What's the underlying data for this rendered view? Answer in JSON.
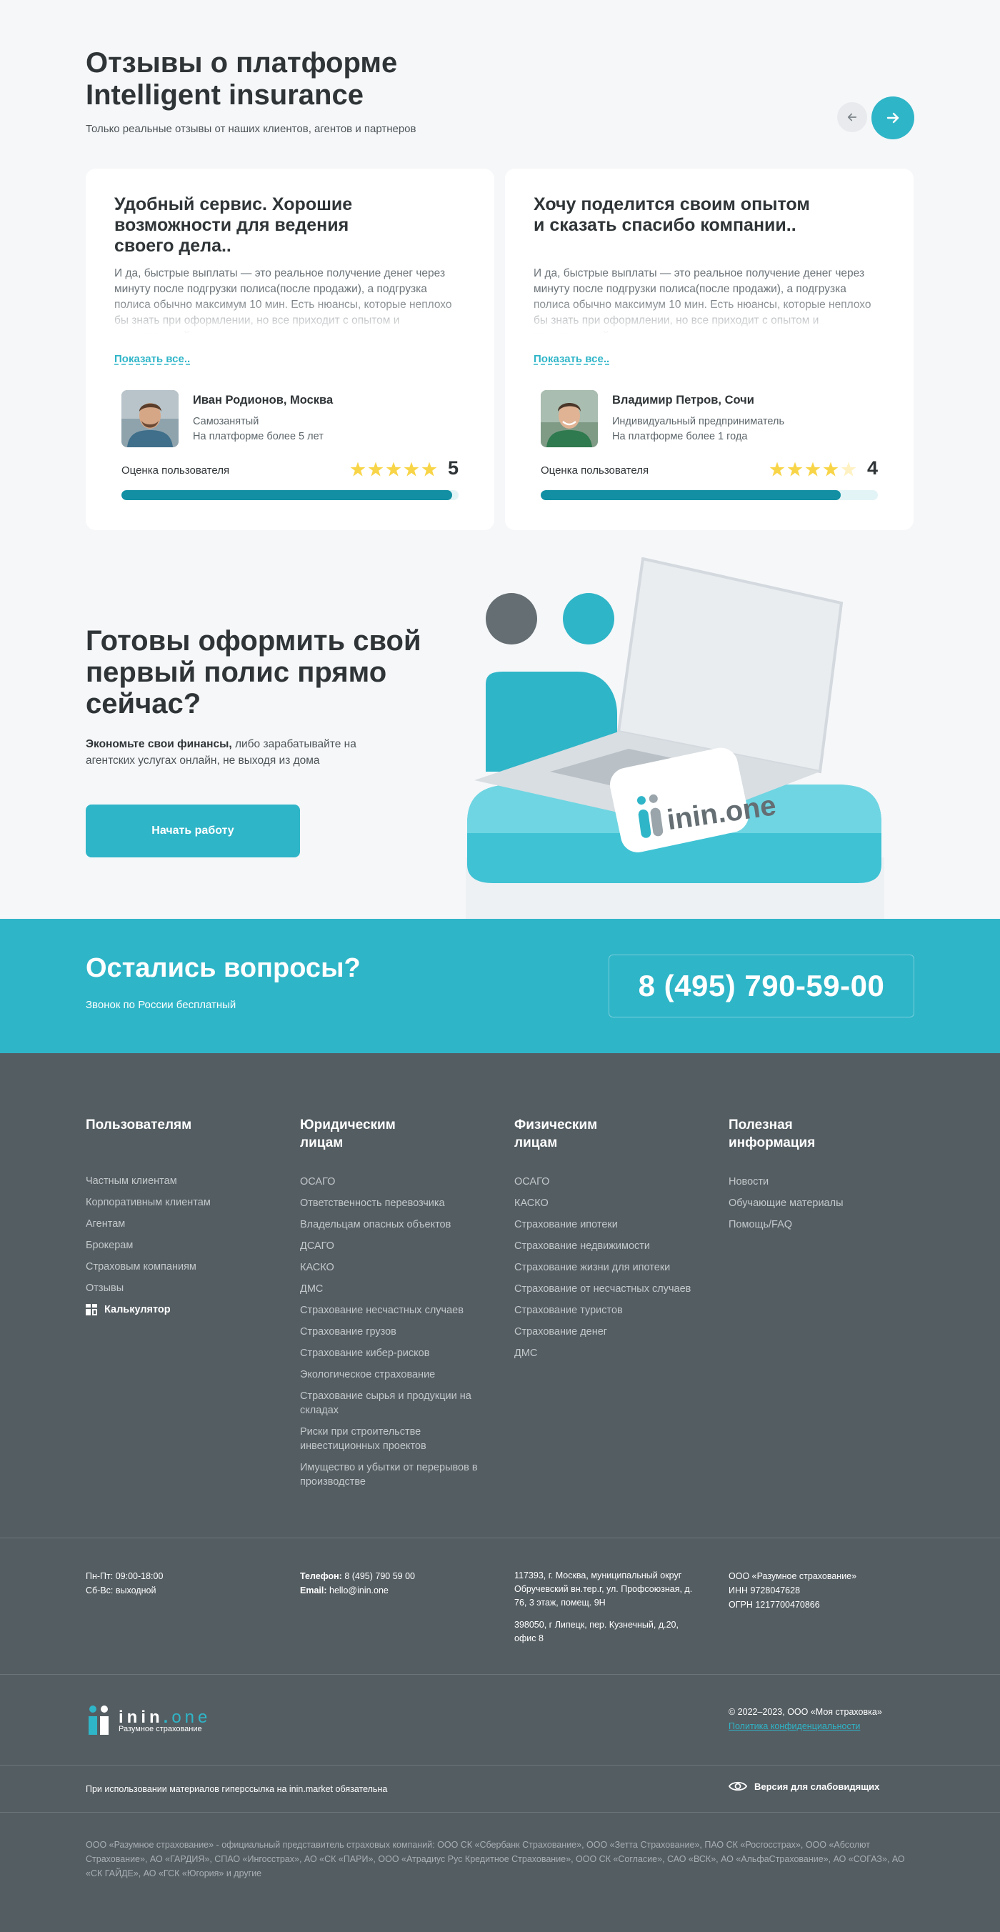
{
  "reviews": {
    "title_line1": "Отзывы о платформе",
    "title_line2": "Intelligent insurance",
    "subtitle": "Только реальные отзывы от наших клиентов, агентов и партнеров",
    "prev_icon": "arrow-left-icon",
    "next_icon": "arrow-right-icon",
    "items": [
      {
        "title": "Удобный сервис. Хорошие возможности для ведения своего дела..",
        "text": "И да, быстрые выплаты — это реальное получение денег через минуту после подгрузки полиса(после продажи), а подгрузка полиса обычно максимум 10 мин. Есть нюансы, которые неплохо бы знать при оформлении, но все приходит с опытом и консультацией.",
        "more": "Показать все..",
        "name": "Иван Родионов, Москва",
        "role": "Самозанятый",
        "tenure": "На платформе более 5 лет",
        "score_label": "Оценка пользователя",
        "score": "5",
        "rating": 5,
        "bar_fraction": 0.98
      },
      {
        "title": "Хочу поделится своим опытом и сказать спасибо компании..",
        "text": "И да, быстрые выплаты — это реальное получение денег через минуту после подгрузки полиса(после продажи), а подгрузка полиса обычно максимум 10 мин. Есть нюансы, которые неплохо бы знать при оформлении, но все приходит с опытом и консультацией.",
        "more": "Показать все..",
        "name": "Владимир Петров, Сочи",
        "role": "Индивидуальный предприниматель",
        "tenure": "На платформе более 1 года",
        "score_label": "Оценка пользователя",
        "score": "4",
        "rating": 4,
        "bar_fraction": 0.89
      }
    ]
  },
  "cta": {
    "title_line1": "Готовы оформить свой",
    "title_line2": "первый полис прямо",
    "title_line3": "сейчас?",
    "text_bold": "Экономьте свои финансы,",
    "text_rest": " либо зарабатывайте на агентских услугах онлайн, не выходя из дома",
    "button": "Начать работу",
    "illus_brand": "inin.one"
  },
  "band": {
    "title": "Остались вопросы?",
    "subtitle": "Звонок по России бесплатный",
    "phone": "8 (495) 790-59-00"
  },
  "footer": {
    "columns": [
      {
        "title": "Пользователям",
        "items": [
          "Частным клиентам",
          "Корпоративным клиентам",
          "Агентам",
          "Брокерам",
          "Страховым компаниям",
          "Отзывы"
        ],
        "extra": "Калькулятор"
      },
      {
        "title": "Юридическим лицам",
        "items": [
          "ОСАГО",
          "Ответственность перевозчика",
          "Владельцам опасных объектов",
          "ДСАГО",
          "КАСКО",
          "ДМС",
          "Страхование несчастных случаев",
          "Страхование грузов",
          "Страхование кибер-рисков",
          "Экологическое страхование",
          "Страхование сырья и продукции на складах",
          "Риски при строительстве инвестиционных проектов",
          "Имущество и убытки от перерывов в производстве"
        ]
      },
      {
        "title": "Физическим лицам",
        "items": [
          "ОСАГО",
          "КАСКО",
          "Страхование ипотеки",
          "Страхование недвижимости",
          "Страхование жизни для ипотеки",
          "Страхование от несчастных случаев",
          "Страхование туристов",
          "Страхование денег",
          "ДМС"
        ]
      },
      {
        "title": "Полезная информация",
        "items": [
          "Новости",
          "Обучающие материалы",
          "Помощь/FAQ"
        ]
      }
    ],
    "hours_1": "Пн-Пт: 09:00-18:00",
    "hours_2": "Сб-Вс: выходной",
    "phone_label": "Телефон:",
    "phone": "8 (495) 790 59 00",
    "email_label": "Email:",
    "email": "hello@inin.one",
    "address_1": "117393, г. Москва, муниципальный округ Обручевский вн.тер.г, ул. Профсоюзная, д. 76, 3 этаж, помещ. 9Н",
    "address_2": "398050, г Липецк, пер. Кузнечный, д.20, офис 8",
    "company": "ООО «Разумное страхование»",
    "inn": "ИНН 9728047628",
    "ogrn": "ОГРН 1217700470866",
    "logo_main": "inin",
    "logo_dot": ".",
    "logo_one": "one",
    "logo_tagline": "Разумное страхование",
    "copyright": "© 2022–2023, ООО «Моя страховка»",
    "privacy": "Политика конфиденциальности",
    "usage_note": "При использовании материалов гиперссылка на inin.market обязательна",
    "a11y": "Версия для слабовидящих",
    "legal": "ООО «Разумное страхование» - официальный представитель страховых компаний: ООО СК «Сбербанк Страхование», ООО «Зетта Страхование», ПАО СК «Росгосстрах», ООО «Абсолют Страхование», АО «ГАРДИЯ», СПАО «Ингосстрах», АО «СК «ПАРИ», ООО «Атрадиус Рус Кредитное Страхование», ООО СК «Согласие», САО «ВСК», АО «АльфаСтрахование», АО «СОГАЗ», АО «СК ГАЙДЕ», АО «ГСК «Югория» и другие"
  },
  "colors": {
    "accent": "#2fb5c8",
    "accent_dark": "#128fa2",
    "footer_bg": "#545d62",
    "page_bg": "#f6f7f9",
    "star": "#f8d548"
  }
}
